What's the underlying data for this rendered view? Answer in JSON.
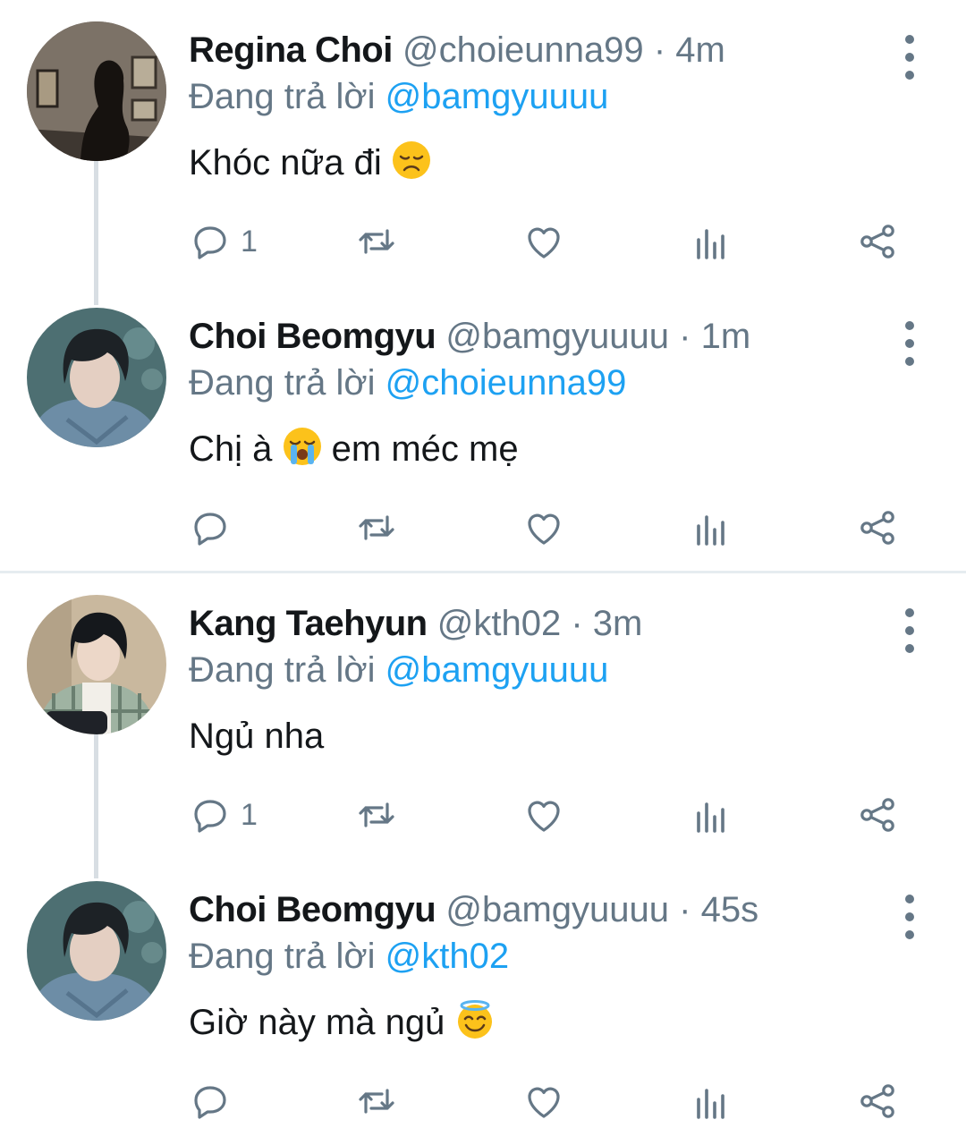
{
  "colors": {
    "accent": "#1da1f2",
    "secondary_text": "#657786",
    "icon": "#657786",
    "thread_line": "#d8dee3"
  },
  "tweets": [
    {
      "name": "Regina Choi",
      "handle": "@choieunna99",
      "separator": "·",
      "time": "4m",
      "replying_prefix": "Đang trả lời",
      "replying_to": "@bamgyuuuu",
      "text": "Khóc nữa đi",
      "emoji": "disappointed-face",
      "reply_count": "1",
      "avatar": "woman-in-gallery-avatar"
    },
    {
      "name": "Choi Beomgyu",
      "handle": "@bamgyuuuu",
      "separator": "·",
      "time": "1m",
      "replying_prefix": "Đang trả lời",
      "replying_to": "@choieunna99",
      "text_before": "Chị à",
      "text_after": "em méc mẹ",
      "emoji": "loudly-crying-face",
      "reply_count": "",
      "avatar": "young-man-sweater-avatar"
    },
    {
      "name": "Kang Taehyun",
      "handle": "@kth02",
      "separator": "·",
      "time": "3m",
      "replying_prefix": "Đang trả lời",
      "replying_to": "@bamgyuuuu",
      "text": "Ngủ nha",
      "reply_count": "1",
      "avatar": "young-man-plaid-avatar"
    },
    {
      "name": "Choi Beomgyu",
      "handle": "@bamgyuuuu",
      "separator": "·",
      "time": "45s",
      "replying_prefix": "Đang trả lời",
      "replying_to": "@kth02",
      "text": "Giờ này mà ngủ",
      "emoji": "smiling-face-with-halo",
      "reply_count": "",
      "avatar": "young-man-sweater-avatar"
    }
  ]
}
